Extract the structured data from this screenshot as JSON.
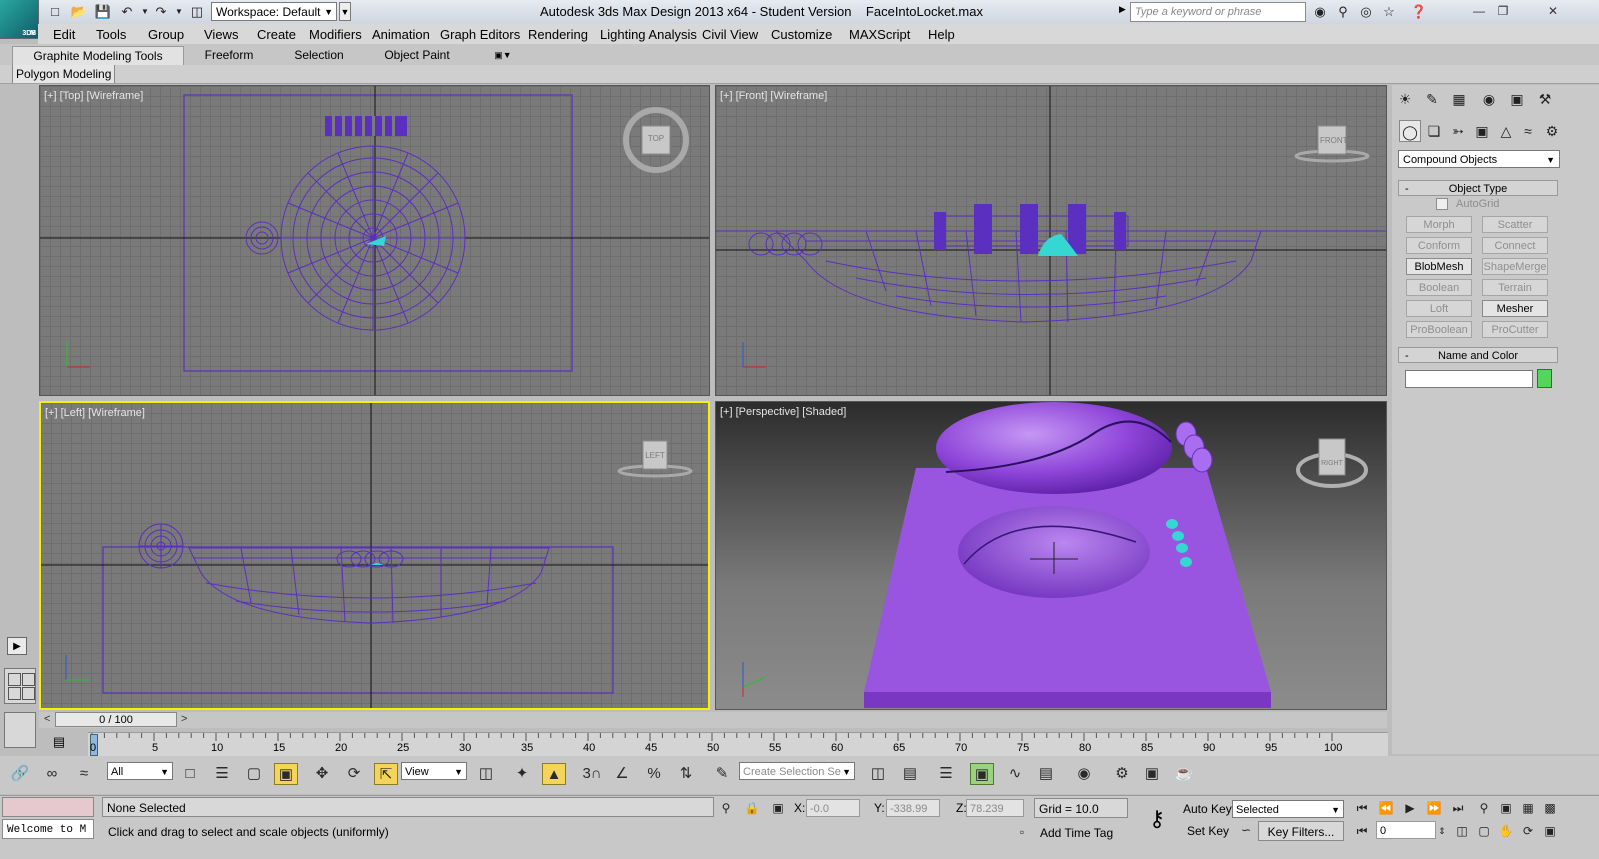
{
  "title_bar": {
    "app_title": "Autodesk 3ds Max Design 2013 x64  -  Student Version",
    "file_name": "FaceIntoLocket.max",
    "workspace_label": "Workspace: Default",
    "search_placeholder": "Type a keyword or phrase",
    "logo_text": "M",
    "logo_sub": "3DS"
  },
  "menu": [
    "Edit",
    "Tools",
    "Group",
    "Views",
    "Create",
    "Modifiers",
    "Animation",
    "Graph Editors",
    "Rendering",
    "Lighting Analysis",
    "Civil View",
    "Customize",
    "MAXScript",
    "Help"
  ],
  "ribbon": {
    "tabs": [
      "Graphite Modeling Tools",
      "Freeform",
      "Selection",
      "Object Paint"
    ],
    "sub_tab": "Polygon Modeling"
  },
  "viewports": {
    "top_label": "[+] [Top] [Wireframe]",
    "front_label": "[+] [Front] [Wireframe]",
    "left_label": "[+] [Left] [Wireframe]",
    "persp_label": "[+] [Perspective] [Shaded]",
    "top_cube": "TOP",
    "front_cube": "FRONT",
    "left_cube": "LEFT",
    "persp_cube": "RIGHT"
  },
  "command_panel": {
    "category": "Compound Objects",
    "object_type_title": "Object Type",
    "autogrid_label": "AutoGrid",
    "buttons": [
      {
        "label": "Morph",
        "enabled": false
      },
      {
        "label": "Scatter",
        "enabled": false
      },
      {
        "label": "Conform",
        "enabled": false
      },
      {
        "label": "Connect",
        "enabled": false
      },
      {
        "label": "BlobMesh",
        "enabled": true
      },
      {
        "label": "ShapeMerge",
        "enabled": false
      },
      {
        "label": "Boolean",
        "enabled": false
      },
      {
        "label": "Terrain",
        "enabled": false
      },
      {
        "label": "Loft",
        "enabled": false
      },
      {
        "label": "Mesher",
        "enabled": true
      },
      {
        "label": "ProBoolean",
        "enabled": false
      },
      {
        "label": "ProCutter",
        "enabled": false
      }
    ],
    "name_color_title": "Name and Color",
    "object_color": "#55d65a",
    "collapse_symbol": "-"
  },
  "time_slider": {
    "frame_readout": "0 / 100",
    "prev": "<",
    "next": ">"
  },
  "track_bar": {
    "ticks": [
      "0",
      "5",
      "10",
      "15",
      "20",
      "25",
      "30",
      "35",
      "40",
      "45",
      "50",
      "55",
      "60",
      "65",
      "70",
      "75",
      "80",
      "85",
      "90",
      "95",
      "100"
    ]
  },
  "toolbar": {
    "selection_filter": "All",
    "ref_coord": "View",
    "named_selection_placeholder": "Create Selection Se"
  },
  "status": {
    "maxscript_listener": "Welcome to M",
    "selection_status": "None Selected",
    "prompt": "Click and drag to select and scale objects (uniformly)",
    "x_label": "X:",
    "x_value": "-0.0",
    "y_label": "Y:",
    "y_value": "-338.99",
    "z_label": "Z:",
    "z_value": "78.239",
    "grid": "Grid = 10.0",
    "add_time_tag": "Add Time Tag",
    "auto_key": "Auto Key",
    "set_key": "Set Key",
    "key_mode": "Selected",
    "key_filters": "Key Filters...",
    "current_frame": "0"
  },
  "colors": {
    "wire": "#5b2fbf",
    "object_purple": "#9a55e0",
    "selection_cyan": "#36d6d2",
    "active_viewport": "#f7f300"
  }
}
